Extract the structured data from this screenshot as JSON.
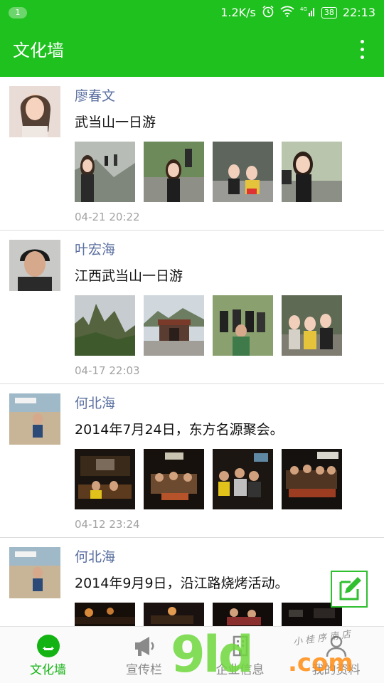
{
  "status_bar": {
    "notification_count": "1",
    "speed": "1.2K/s",
    "network": "4G",
    "battery": "38",
    "time": "22:13"
  },
  "app_bar": {
    "title": "文化墙"
  },
  "posts": [
    {
      "name": "廖春文",
      "content": "武当山一日游",
      "time": "04-21 20:22"
    },
    {
      "name": "叶宏海",
      "content": "江西武当山一日游",
      "time": "04-17 22:03"
    },
    {
      "name": "何北海",
      "content": "2014年7月24日，东方名源聚会。",
      "time": "04-12 23:24"
    },
    {
      "name": "何北海",
      "content": "2014年9月9日，沿江路烧烤活动。",
      "time": ""
    }
  ],
  "bottom_nav": [
    {
      "label": "文化墙",
      "icon": "culture-wall-icon",
      "active": true
    },
    {
      "label": "宣传栏",
      "icon": "megaphone-icon",
      "active": false
    },
    {
      "label": "企业信息",
      "icon": "building-icon",
      "active": false
    },
    {
      "label": "我的资料",
      "icon": "profile-icon",
      "active": false
    }
  ],
  "watermark": {
    "brand": "9ld",
    "domain": ".com",
    "handwriting": "小 桂 序 南 店"
  },
  "colors": {
    "accent": "#1ec11e",
    "active_nav": "#13b313",
    "name_text": "#5a6fa0",
    "time_text": "#a3a3a3"
  }
}
